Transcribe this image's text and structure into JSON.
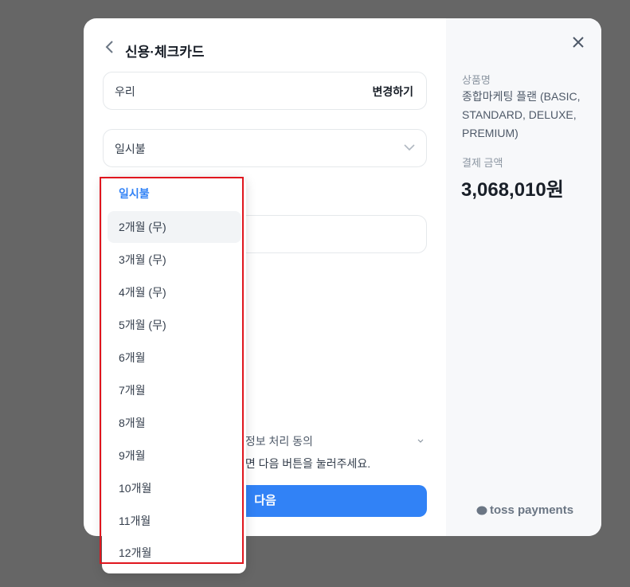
{
  "header": {
    "title": "신용·체크카드"
  },
  "card": {
    "value": "우리",
    "change_label": "변경하기"
  },
  "installment": {
    "selected": "일시불"
  },
  "options": [
    "일시불",
    "2개월 (무)",
    "3개월 (무)",
    "4개월 (무)",
    "5개월 (무)",
    "6개월",
    "7개월",
    "8개월",
    "9개월",
    "10개월",
    "11개월",
    "12개월"
  ],
  "agreement": {
    "label_partial": "인정보 처리 동의",
    "hint_partial": "시면 다음 버튼을 눌러주세요."
  },
  "next_label": "다음",
  "summary": {
    "product_label": "상품명",
    "product_name": "종합마케팅 플랜 (BASIC, STANDARD, DELUXE, PREMIUM)",
    "amount_label": "결제 금액",
    "amount": "3,068,010원"
  },
  "brand": "toss payments",
  "colors": {
    "accent": "#3182f6",
    "highlight": "#e0161e"
  }
}
